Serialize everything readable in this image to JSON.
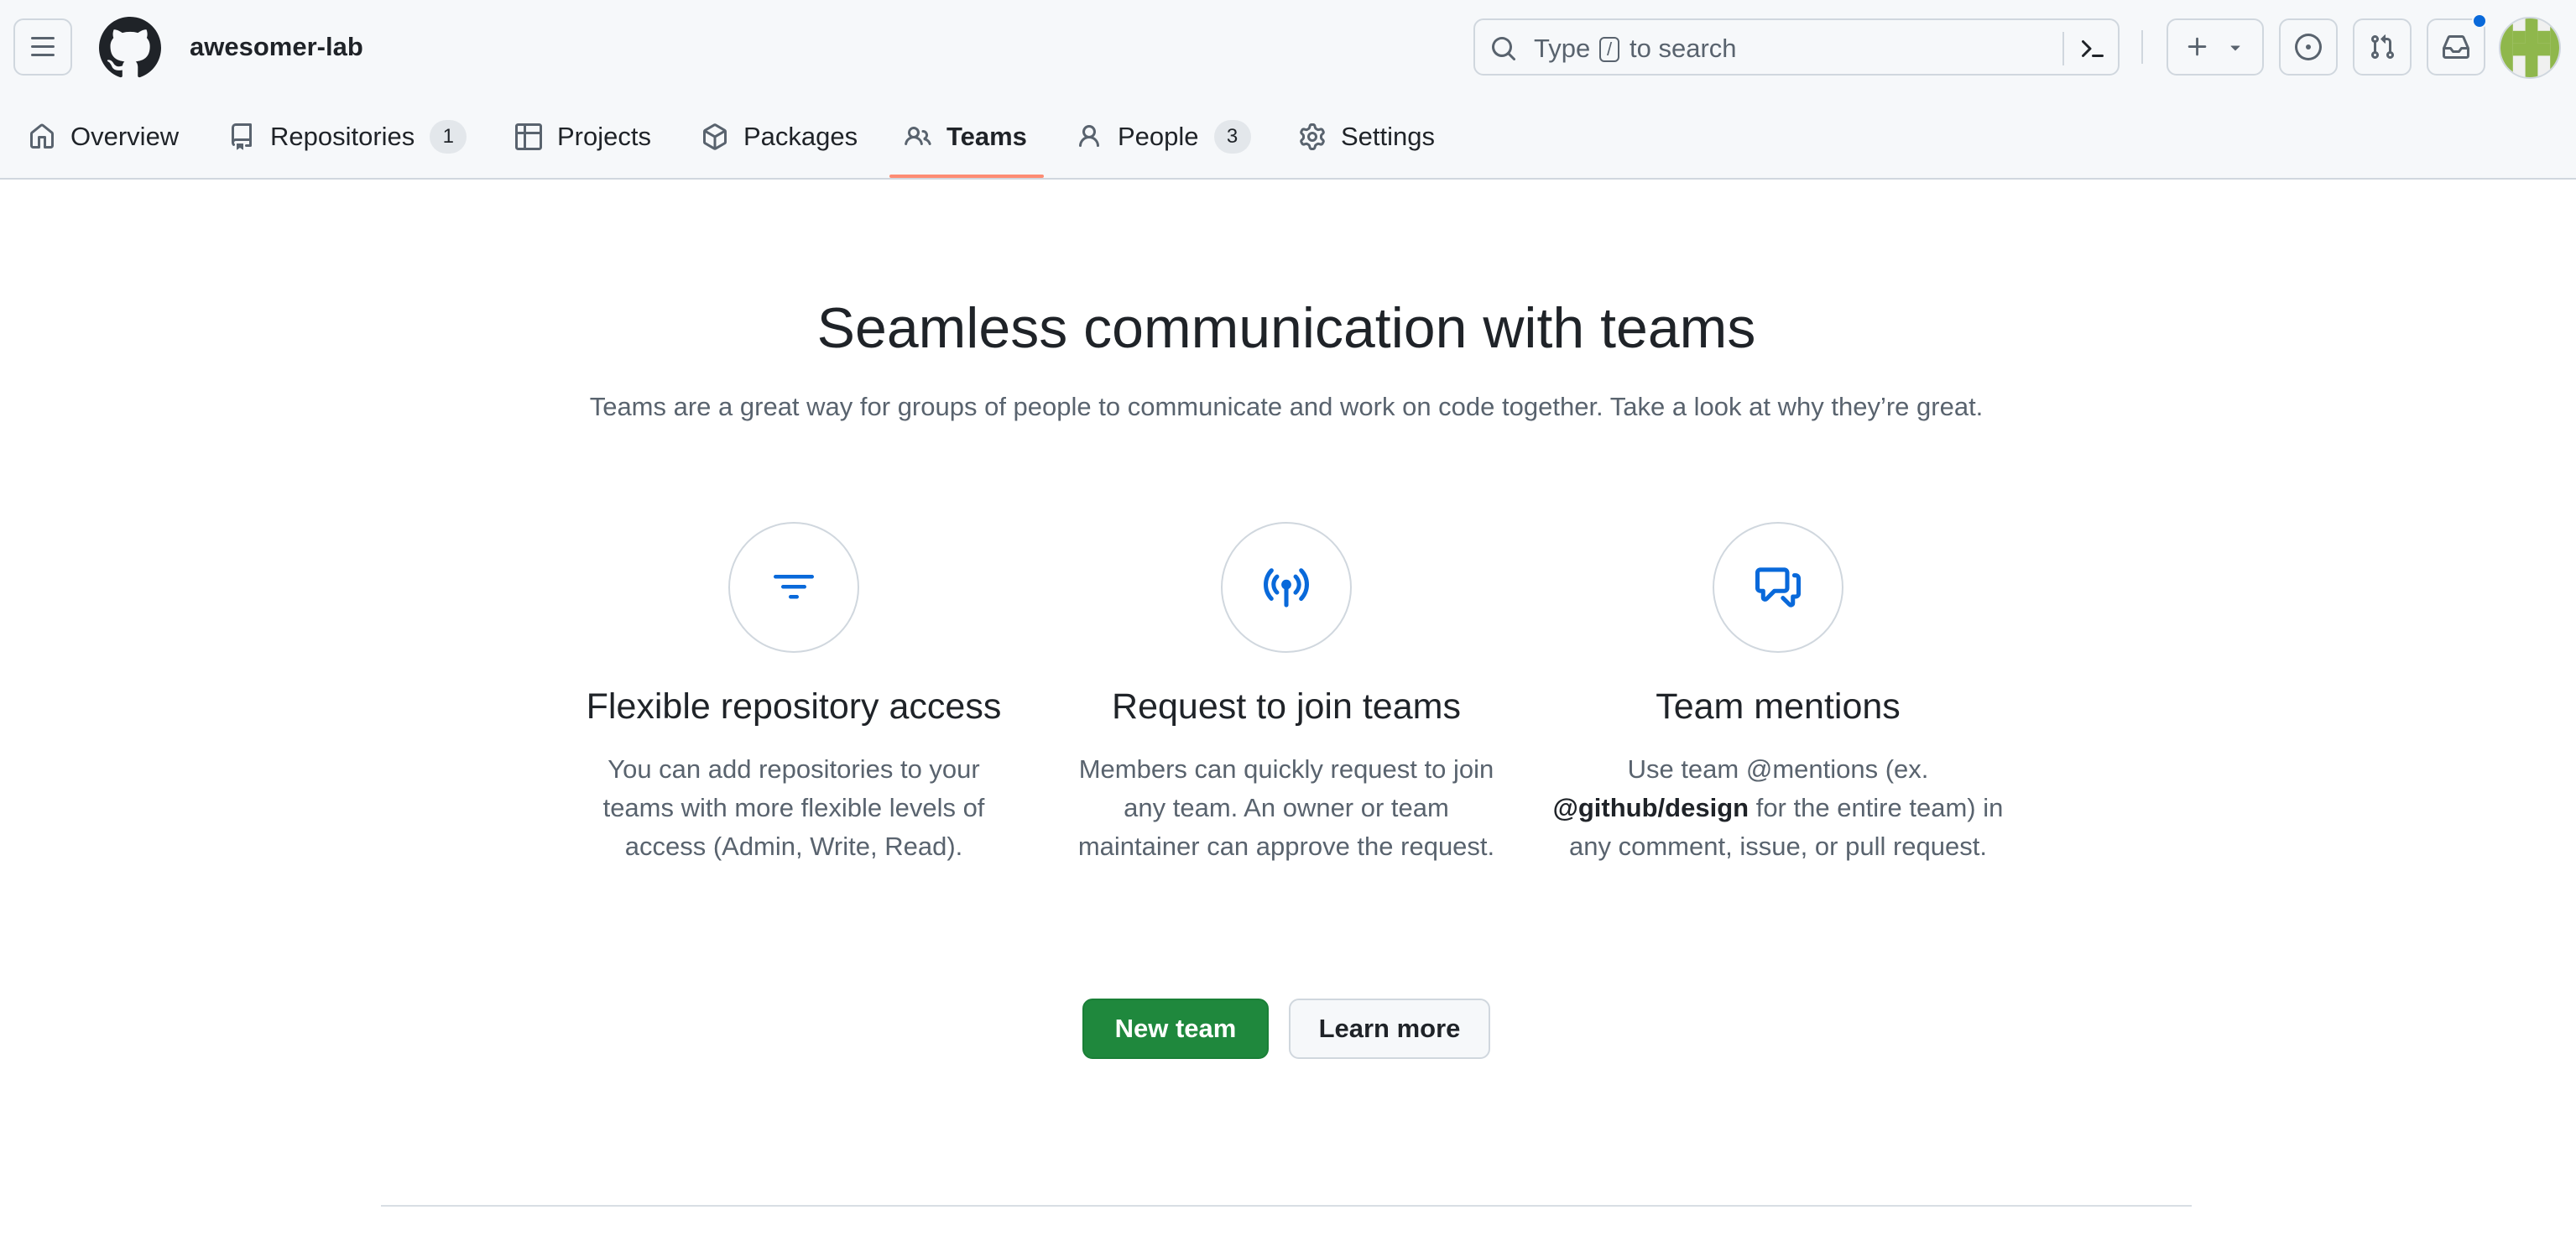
{
  "header": {
    "org_name": "awesomer-lab",
    "search": {
      "placeholder_prefix": "Type",
      "slash_key": "/",
      "placeholder_suffix": "to search"
    },
    "icons": {
      "menu": "three-bars-icon",
      "logo": "github-mark-icon",
      "search": "search-icon",
      "command_palette": "terminal-icon",
      "create": "plus-icon",
      "create_caret": "triangle-down-icon",
      "issues": "issue-opened-icon",
      "pull_requests": "git-pull-request-icon",
      "inbox": "inbox-icon"
    },
    "has_unread_notifications": true
  },
  "tabs": [
    {
      "label": "Overview",
      "icon": "home-icon"
    },
    {
      "label": "Repositories",
      "icon": "repo-icon",
      "count": "1"
    },
    {
      "label": "Projects",
      "icon": "table-icon"
    },
    {
      "label": "Packages",
      "icon": "package-icon"
    },
    {
      "label": "Teams",
      "icon": "people-icon",
      "selected": true
    },
    {
      "label": "People",
      "icon": "person-icon",
      "count": "3"
    },
    {
      "label": "Settings",
      "icon": "gear-icon"
    }
  ],
  "main": {
    "title": "Seamless communication with teams",
    "subtitle": "Teams are a great way for groups of people to communicate and work on code together. Take a look at why they’re great.",
    "features": [
      {
        "icon": "filter-icon",
        "title": "Flexible repository access",
        "description": "You can add repositories to your teams with more flexible levels of access (Admin, Write, Read)."
      },
      {
        "icon": "broadcast-icon",
        "title": "Request to join teams",
        "description": "Members can quickly request to join any team. An owner or team maintainer can approve the request."
      },
      {
        "icon": "comment-discussion-icon",
        "title": "Team mentions",
        "description_pre": "Use team @mentions (ex.",
        "description_bold": "@github/design",
        "description_post": "for the entire team) in any comment, issue, or pull request."
      }
    ],
    "primary_button": "New team",
    "secondary_button": "Learn more"
  },
  "colors": {
    "accent_blue": "#0969da",
    "primary_green": "#1f883d",
    "tab_underline": "#fd8c73",
    "header_bg": "#f6f8fa",
    "border": "#d0d7de",
    "avatar_green": "#8fb74c"
  }
}
